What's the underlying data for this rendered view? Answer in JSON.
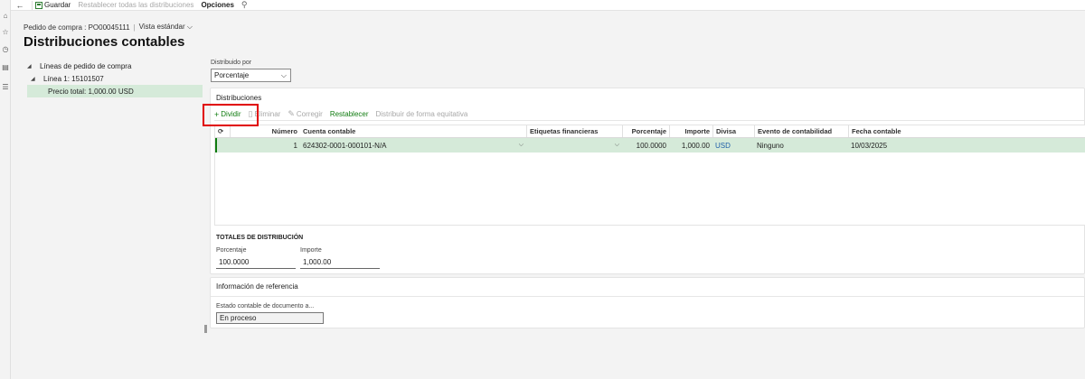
{
  "toolbar": {
    "save": "Guardar",
    "reset_all": "Restablecer todas las distribuciones",
    "options": "Opciones"
  },
  "breadcrumb": {
    "record": "Pedido de compra : PO00045111",
    "view": "Vista estándar"
  },
  "page_title": "Distribuciones contables",
  "tree": {
    "root": "Líneas de pedido de compra",
    "line": "Línea 1: 15101507",
    "total": "Precio total: 1,000.00 USD"
  },
  "distributed_by": {
    "label": "Distribuido por",
    "value": "Porcentaje"
  },
  "distributions": {
    "title": "Distribuciones",
    "actions": {
      "split": "Dividir",
      "delete": "Eliminar",
      "correct": "Corregir",
      "reset": "Restablecer",
      "distribute_evenly": "Distribuir de forma equitativa"
    },
    "columns": {
      "number": "Número",
      "account": "Cuenta contable",
      "tags": "Etiquetas financieras",
      "percent": "Porcentaje",
      "amount": "Importe",
      "currency": "Divisa",
      "event": "Evento de contabilidad",
      "date": "Fecha contable"
    },
    "rows": [
      {
        "number": "1",
        "account": "624302-0001-000101-N/A",
        "tags": "",
        "percent": "100.0000",
        "amount": "1,000.00",
        "currency": "USD",
        "event": "Ninguno",
        "date": "10/03/2025"
      }
    ]
  },
  "totals": {
    "title": "TOTALES DE DISTRIBUCIÓN",
    "percent_label": "Porcentaje",
    "percent_value": "100.0000",
    "amount_label": "Importe",
    "amount_value": "1,000.00"
  },
  "reference": {
    "title": "Información de referencia",
    "status_label": "Estado contable de documento a...",
    "status_value": "En proceso"
  },
  "colors": {
    "accent_green": "#107c10",
    "selected_row": "#d5ead9",
    "highlight_box": "#e00000"
  }
}
